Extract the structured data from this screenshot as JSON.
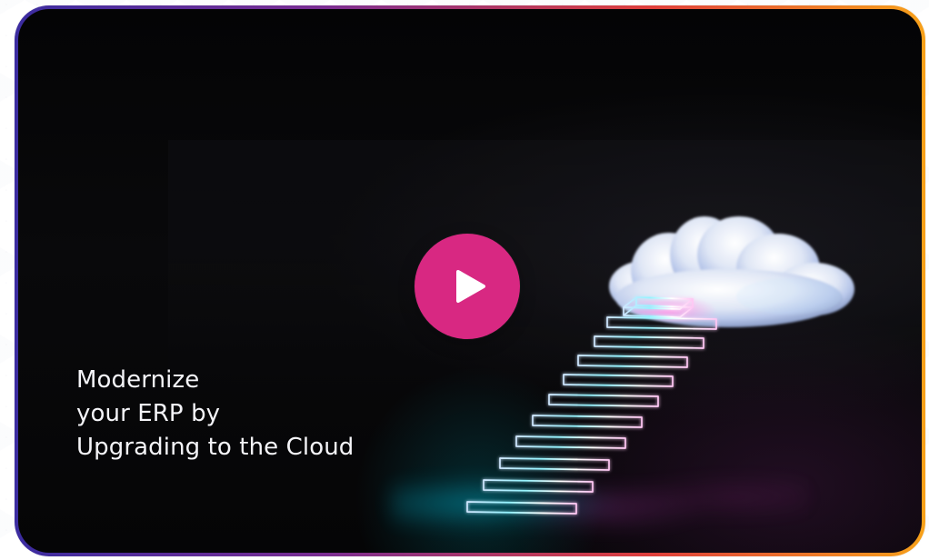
{
  "headline": {
    "line1": "Modernize",
    "line2": "your ERP by",
    "line3": "Upgrading to the Cloud"
  },
  "video": {
    "play_button_color": "#d82882",
    "play_icon": "play-icon"
  },
  "visual": {
    "subject": "cloud-and-stairs-illustration",
    "icons": [
      "cloud-icon",
      "stairs-icon"
    ],
    "colors": {
      "frame_start": "#3b2ca0",
      "frame_mid": "#7a2d92",
      "frame_warm": "#df3f3b",
      "frame_end": "#f7a11a",
      "background": "#050506",
      "cyan_glow": "#00dfff",
      "pink_glow": "#e06fe6"
    }
  }
}
